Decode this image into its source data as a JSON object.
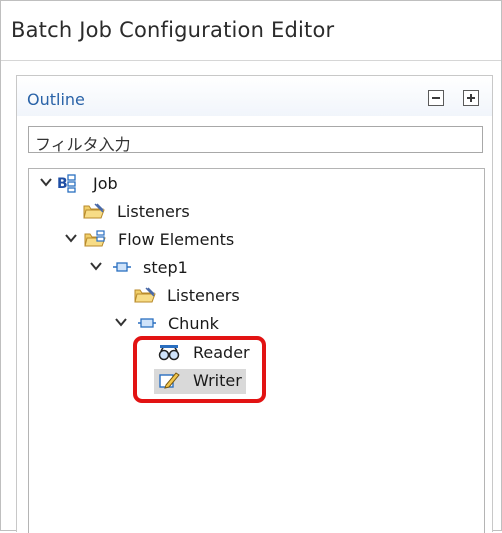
{
  "editor": {
    "title": "Batch Job Configuration Editor"
  },
  "outline": {
    "title": "Outline",
    "collapse_all_icon": "collapse-all-icon",
    "expand_all_icon": "expand-all-icon",
    "filter": {
      "value": "フィルタ入力"
    },
    "tree": [
      {
        "label": "Job",
        "icon": "job-icon",
        "expanded": true
      },
      {
        "label": "Listeners",
        "icon": "listeners-folder-icon"
      },
      {
        "label": "Flow Elements",
        "icon": "flow-elements-folder-icon",
        "expanded": true
      },
      {
        "label": "step1",
        "icon": "step-icon",
        "expanded": true
      },
      {
        "label": "Listeners",
        "icon": "listeners-folder-icon"
      },
      {
        "label": "Chunk",
        "icon": "chunk-icon",
        "expanded": true
      },
      {
        "label": "Reader",
        "icon": "reader-icon"
      },
      {
        "label": "Writer",
        "icon": "writer-icon",
        "selected": true
      }
    ]
  },
  "colors": {
    "highlight_border": "#e21313",
    "outline_title": "#2a63a8",
    "selection": "#d9d9d9"
  }
}
